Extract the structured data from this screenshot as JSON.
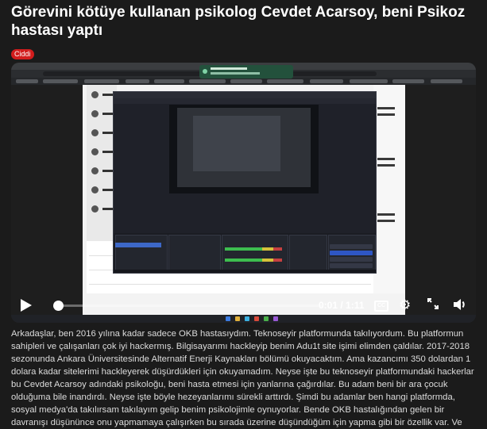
{
  "title": "Görevini kötüye kullanan psikolog Cevdet Acarsoy, beni Psikoz hastası yaptı",
  "badge": "Ciddi",
  "video": {
    "time_display": "0:01 / 1:11",
    "progress": 0.014,
    "cc_label": "CC",
    "controls": [
      "play-icon",
      "cc-icon",
      "gear-icon",
      "fullscreen-icon",
      "volume-icon"
    ]
  },
  "body": "Arkadaşlar, ben 2016 yılına kadar sadece OKB hastasıydım. Teknoseyir platformunda takılıyordum. Bu platformun sahipleri ve çalışanları çok iyi hackermış. Bilgisayarımı hackleyip benim Adu1t site işimi elimden çaldılar. 2017-2018 sezonunda Ankara Üniversitesinde Alternatif Enerji Kaynakları bölümü okuyacaktım. Ama kazancımı 350 dolardan 1 dolara kadar sitelerimi hackleyerek düşürdükleri için okuyamadım. Neyse işte bu teknoseyir platformundaki hackerlar bu Cevdet Acarsoy adındaki psikoloğu, beni hasta etmesi için yanlarına çağırdılar. Bu adam beni bir ara çocuk olduğuma bile inandırdı. Neyse işte böyle hezeyanlarımı sürekli arttırdı. Şimdi bu adamlar ben hangi platformda, sosyal medya'da takılırsam takılayım gelip benim psikolojimle oynuyorlar. Bende OKB hastalığından gelen bir davranışı düşününce onu yapmamaya çalışırken bu sırada üzerine düşündüğüm için yapma gibi bir özellik var. Ve",
  "colors": {
    "badge": "#d21d1d",
    "background": "#1b1b1b",
    "notify": "#23513c",
    "record": "#2e56c4"
  }
}
